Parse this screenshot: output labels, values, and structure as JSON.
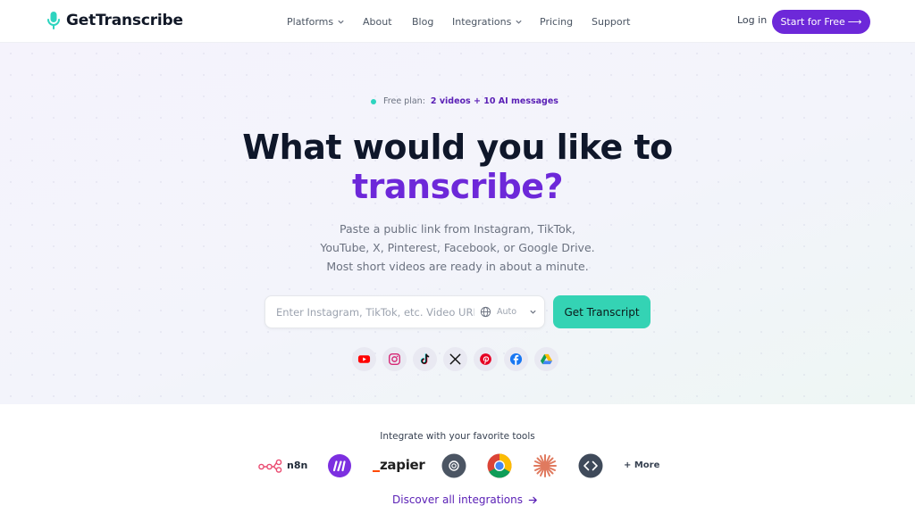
{
  "brand": {
    "name": "GetTranscribe"
  },
  "nav": {
    "platforms": "Platforms",
    "about": "About",
    "blog": "Blog",
    "integrations": "Integrations",
    "pricing": "Pricing",
    "support": "Support",
    "login": "Log in",
    "cta": "Start for Free",
    "cta_arrow": "⟶"
  },
  "hero": {
    "plan_label": "Free plan:",
    "plan_value": "2 videos + 10 AI messages",
    "title_line1": "What would you like to",
    "title_line2": "transcribe?",
    "subtitle_line1": "Paste a public link from Instagram, TikTok,",
    "subtitle_line2": "YouTube, X, Pinterest, Facebook, or Google Drive.",
    "subtitle_line3": "Most short videos are ready in about a minute.",
    "search_placeholder": "Enter Instagram, TikTok, etc. Video URL...",
    "language": "Auto",
    "submit": "Get Transcript"
  },
  "platform_icons": [
    "youtube-icon",
    "instagram-icon",
    "tiktok-icon",
    "x-icon",
    "pinterest-icon",
    "facebook-icon",
    "google-drive-icon"
  ],
  "integrations": {
    "title": "Integrate with your favorite tools",
    "n8n": "n8n",
    "zapier": "zapier",
    "more": "+ More",
    "discover": "Discover all integrations",
    "icons": [
      "n8n-icon",
      "make-icon",
      "zapier-icon",
      "openai-icon",
      "chrome-icon",
      "claude-icon",
      "api-code-icon"
    ]
  },
  "colors": {
    "brand_purple": "#6d28d9",
    "accent_teal": "#34d3b4",
    "status_dot": "#2dd4bf"
  }
}
